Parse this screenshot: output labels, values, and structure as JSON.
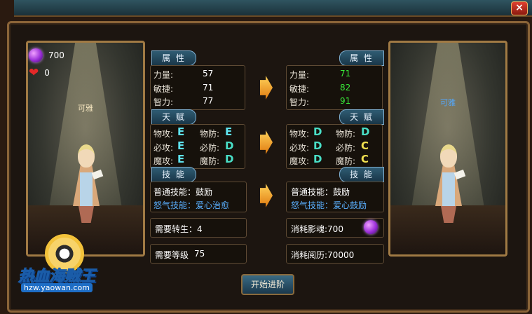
{
  "left": {
    "currency": "700",
    "hearts": "0",
    "char_name": "可雅",
    "attr_tab": "属 性",
    "attrs": [
      {
        "label": "力量:",
        "value": "57"
      },
      {
        "label": "敏捷:",
        "value": "71"
      },
      {
        "label": "智力:",
        "value": "77"
      }
    ],
    "talent_tab": "天 赋",
    "talents": [
      {
        "label": "物攻:",
        "grade": "E"
      },
      {
        "label": "物防:",
        "grade": "E"
      },
      {
        "label": "必攻:",
        "grade": "E"
      },
      {
        "label": "必防:",
        "grade": "D"
      },
      {
        "label": "魔攻:",
        "grade": "E"
      },
      {
        "label": "魔防:",
        "grade": "D"
      }
    ],
    "skill_tab": "技 能",
    "normal_skill": "普通技能：鼓励",
    "rage_skill_label": "怒气技能：",
    "rage_skill_value": "爱心治愈",
    "rebirth_req": "需要转生：4",
    "level_req_label": "需要等级",
    "level_req_value": "75"
  },
  "right": {
    "char_name": "可雅",
    "attr_tab": "属 性",
    "attrs": [
      {
        "label": "力量:",
        "value": "71"
      },
      {
        "label": "敏捷:",
        "value": "82"
      },
      {
        "label": "智力:",
        "value": "91"
      }
    ],
    "talent_tab": "天 赋",
    "talents": [
      {
        "label": "物攻:",
        "grade": "D"
      },
      {
        "label": "物防:",
        "grade": "D"
      },
      {
        "label": "必攻:",
        "grade": "D"
      },
      {
        "label": "必防:",
        "grade": "C"
      },
      {
        "label": "魔攻:",
        "grade": "D"
      },
      {
        "label": "魔防:",
        "grade": "C"
      }
    ],
    "skill_tab": "技 能",
    "normal_skill": "普通技能：鼓励",
    "rage_skill_label": "怒气技能：",
    "rage_skill_value": "爱心鼓励",
    "soul_cost": "消耗影魂:700",
    "exp_cost": "消耗阅历:70000"
  },
  "start_button": "开始进阶",
  "close_icon": "×",
  "logo": {
    "text_red": "热血",
    "text_main": "海贼王",
    "url": "hzw.yaowan.com"
  },
  "colors": {
    "upgrade_green": "#38e838",
    "grade_d": "#49dfc7",
    "grade_c": "#f0e050",
    "grade_e": "#5fe3ef"
  }
}
